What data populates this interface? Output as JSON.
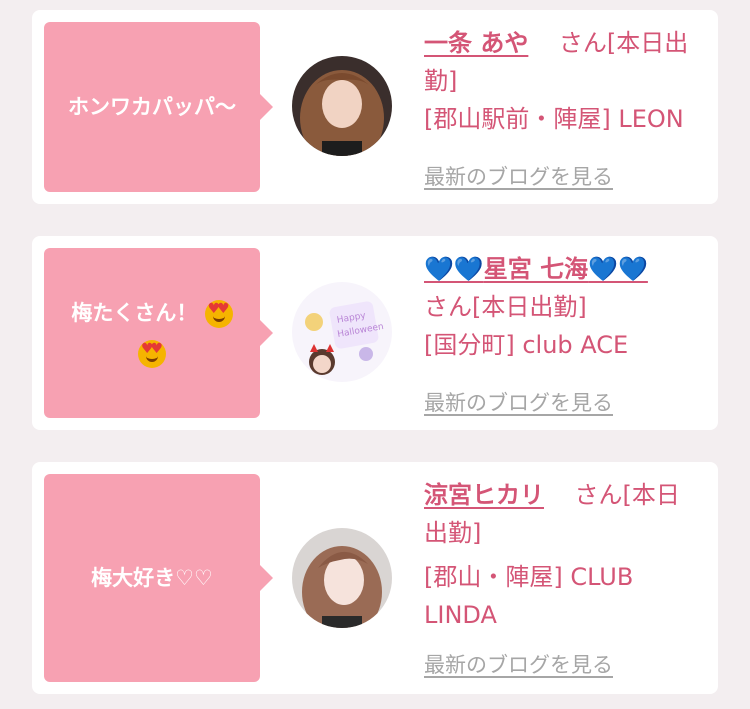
{
  "cards": [
    {
      "message": "ホンワカパッパ〜",
      "name": "一条 あや",
      "suffix": "さん[本日出勤]",
      "suffix_a": "さん[本日出",
      "suffix_b": "勤]",
      "location": "[郡山駅前・陣屋] LEON",
      "blog_link": "最新のブログを見る"
    },
    {
      "message": "梅たくさん！",
      "emoji": "smiling-face-with-heart-eyes",
      "name": "💙💙星宮 七海💙💙",
      "name_text": "星宮 七海",
      "suffix": "さん[本日出勤]",
      "location": "[国分町] club ACE",
      "blog_link": "最新のブログを見る"
    },
    {
      "message": "梅大好き♡♡",
      "name": "涼宮ヒカリ",
      "suffix": "さん[本日出勤]",
      "suffix_a": "さん[本日",
      "suffix_b": "出勤]",
      "location": "[郡山・陣屋] CLUB LINDA",
      "location_a": "[郡山・陣屋] CLUB",
      "location_b": "LINDA",
      "blog_link": "最新のブログを見る"
    }
  ],
  "colors": {
    "bubble": "#f7a1b2",
    "name": "#d45576",
    "link": "#a6a6a6",
    "background": "#f3eef0"
  }
}
